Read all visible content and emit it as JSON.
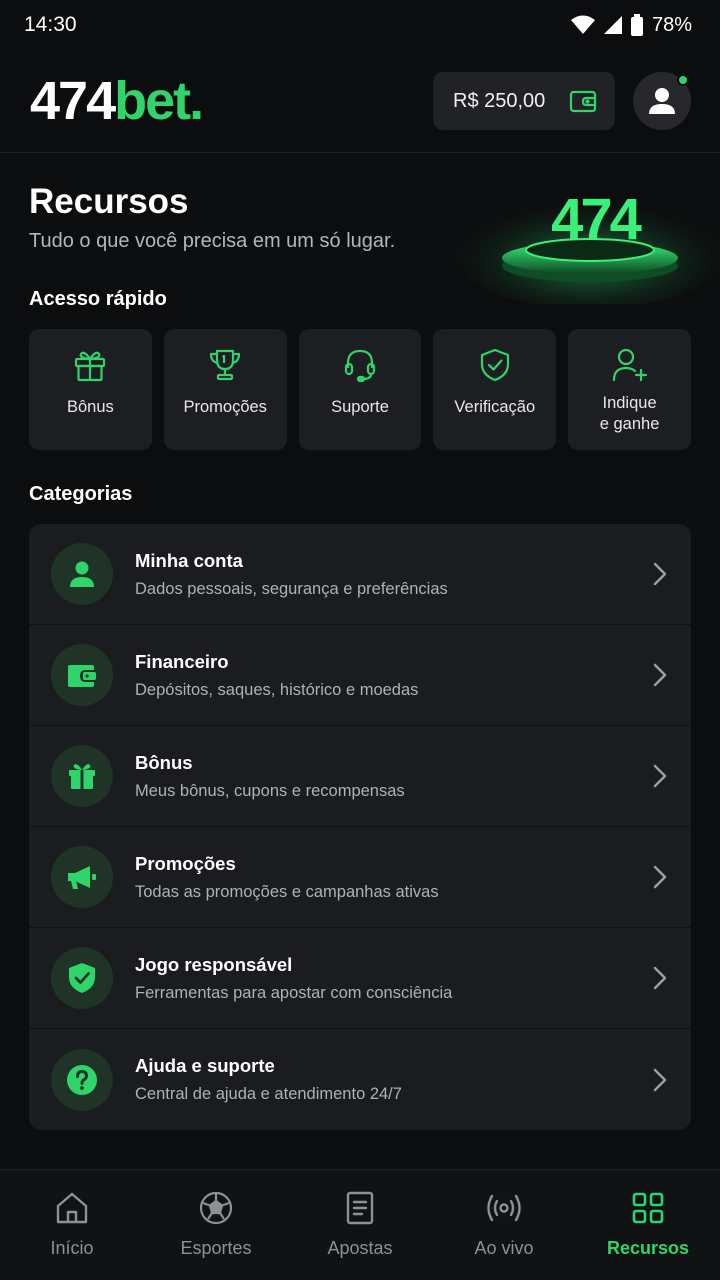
{
  "status_bar": {
    "time": "14:30",
    "battery": "78%"
  },
  "header": {
    "logo_part1": "474",
    "logo_part2": "bet.",
    "balance": "R$ 250,00"
  },
  "hero": {
    "title": "Recursos",
    "subtitle": "Tudo o que você precisa em um só lugar.",
    "art_text": "474"
  },
  "quick_access": {
    "title": "Acesso rápido",
    "items": [
      {
        "label": "Bônus",
        "icon": "gift-icon"
      },
      {
        "label": "Promoções",
        "icon": "trophy-icon"
      },
      {
        "label": "Suporte",
        "icon": "headset-icon"
      },
      {
        "label": "Verificação",
        "icon": "shield-check-icon"
      },
      {
        "label": "Indique\ne ganhe",
        "icon": "user-plus-icon"
      }
    ]
  },
  "categories": {
    "title": "Categorias",
    "items": [
      {
        "title": "Minha conta",
        "subtitle": "Dados pessoais, segurança e preferências",
        "icon": "user-icon"
      },
      {
        "title": "Financeiro",
        "subtitle": "Depósitos, saques, histórico e moedas",
        "icon": "wallet-icon"
      },
      {
        "title": "Bônus",
        "subtitle": "Meus bônus, cupons e recompensas",
        "icon": "gift-icon"
      },
      {
        "title": "Promoções",
        "subtitle": "Todas as promoções e campanhas ativas",
        "icon": "megaphone-icon"
      },
      {
        "title": "Jogo responsável",
        "subtitle": "Ferramentas para apostar com consciência",
        "icon": "shield-check-icon"
      },
      {
        "title": "Ajuda e suporte",
        "subtitle": "Central de ajuda e atendimento 24/7",
        "icon": "question-icon"
      }
    ]
  },
  "bottom_nav": {
    "items": [
      {
        "label": "Início",
        "icon": "home-icon"
      },
      {
        "label": "Esportes",
        "icon": "soccer-ball-icon"
      },
      {
        "label": "Apostas",
        "icon": "bet-slip-icon"
      },
      {
        "label": "Ao vivo",
        "icon": "live-icon"
      },
      {
        "label": "Recursos",
        "icon": "grid-icon",
        "active": true
      }
    ]
  },
  "colors": {
    "accent": "#2fd46a",
    "background": "#0c0d0f",
    "card": "#1c1e21"
  }
}
